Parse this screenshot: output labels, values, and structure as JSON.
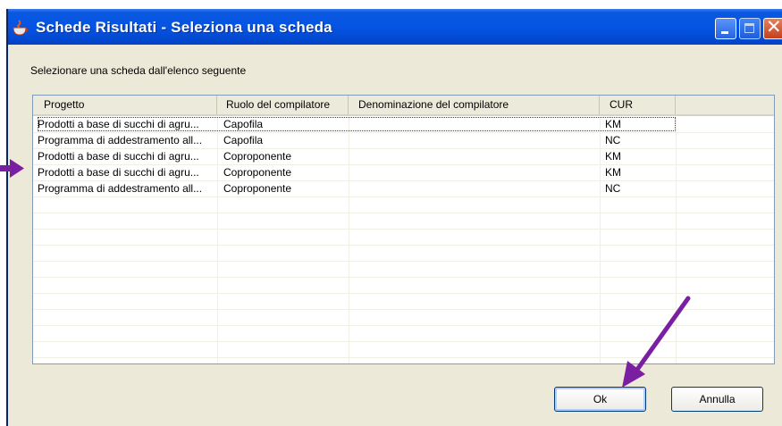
{
  "window": {
    "title": "Schede Risultati - Seleziona una scheda"
  },
  "instruction": "Selezionare una scheda dall'elenco seguente",
  "table": {
    "columns": [
      "Progetto",
      "Ruolo del compilatore",
      "Denominazione del compilatore",
      "CUR",
      ""
    ],
    "rows": [
      {
        "progetto": "Prodotti a base di succhi di agru...",
        "ruolo": "Capofila",
        "denominazione": "",
        "cur": "KM"
      },
      {
        "progetto": "Programma di addestramento all...",
        "ruolo": "Capofila",
        "denominazione": "",
        "cur": "NC"
      },
      {
        "progetto": "Prodotti a base di succhi di agru...",
        "ruolo": "Coproponente",
        "denominazione": "",
        "cur": "KM"
      },
      {
        "progetto": "Prodotti a base di succhi di agru...",
        "ruolo": "Coproponente",
        "denominazione": "",
        "cur": "KM"
      },
      {
        "progetto": "Programma di addestramento all...",
        "ruolo": "Coproponente",
        "denominazione": "",
        "cur": "NC"
      }
    ],
    "empty_row_count": 11
  },
  "buttons": {
    "ok": "Ok",
    "cancel": "Annulla"
  },
  "icons": {
    "app": "java-cup-icon",
    "minimize": "minimize-icon",
    "maximize": "maximize-icon",
    "close": "close-icon"
  },
  "colors": {
    "titlebar": "#0554e3",
    "annotation_arrow": "#7b1fa2"
  }
}
